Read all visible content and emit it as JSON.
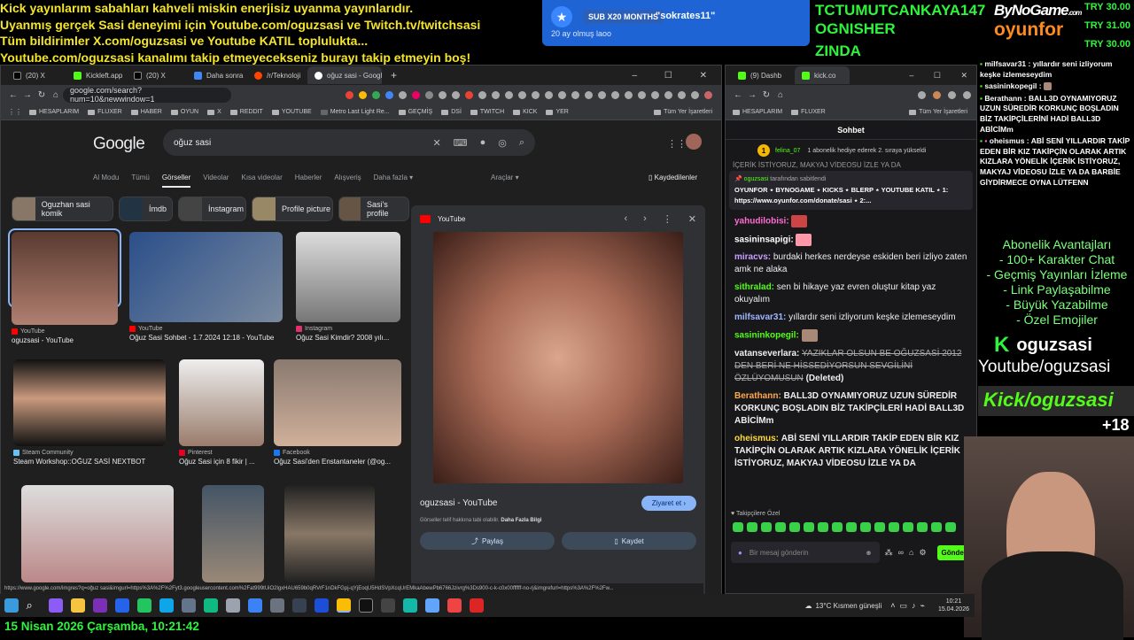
{
  "ticker": [
    "Kick yayınlarım sabahları kahveli miskin enerjisiz uyanma yayınlarıdır.",
    "Uyanmış gerçek Sasi deneyimi için Youtube.com/oguzsasi ve Twitch.tv/twitchsasi",
    "Tüm bildirimler X.com/oguzsasi ve Youtube KATIL toplulukta...",
    "Youtube.com/oguzsasi kanalımı takip etmeyecekseniz burayı takip etmeyin boş!"
  ],
  "sub_alert": {
    "tag": "SUB X20 MONTHS",
    "name": "\"sokrates11\"",
    "ago": "20 ay olmuş laoo"
  },
  "top_names": [
    "TCTUMUTCANKAYA147",
    "OGNISHER",
    "ZINDA"
  ],
  "logo": {
    "line1": "ByNoGame",
    "line1_small": ".com",
    "line2": "oyunfor"
  },
  "tries": [
    "TRY 30.00",
    "TRY 31.00",
    "TRY 30.00"
  ],
  "left_browser": {
    "tabs": [
      "(20) X",
      "Kickleft.app - Kick Chat",
      "(20) X",
      "Daha sonra oku",
      "/r/Teknoloji",
      "oğuz sasi - Google'da"
    ],
    "url": "google.com/search?num=10&newwindow=1",
    "bookmarks": [
      "HESAPLARIM",
      "FLUXER",
      "HABER",
      "OYUN",
      "X",
      "REDDIT",
      "YOUTUBE",
      "Metro Last Light Re...",
      "GEÇMİŞ",
      "DSİ",
      "TWITCH",
      "KICK",
      "YER"
    ],
    "bookmarks_all": "Tüm Yer İşaretleri",
    "search": {
      "query": "oğuz sasi",
      "logo": "Google"
    },
    "nav": [
      "Al Modu",
      "Tümü",
      "Görseller",
      "Videolar",
      "Kısa videolar",
      "Haberler",
      "Alışveriş",
      "Daha fazla ▾"
    ],
    "tools": "Araçlar ▾",
    "saved": "Kaydedilenler",
    "chips": [
      "Oguzhan sasi komik",
      "İmdb",
      "İnstagram",
      "Profile picture",
      "Sasi's profile"
    ],
    "results": [
      {
        "src": "YouTube",
        "title": "oguzsasi - YouTube"
      },
      {
        "src": "YouTube",
        "title": "Oğuz Sasi Sohbet - 1.7.2024 12:18 - YouTube"
      },
      {
        "src": "Instagram",
        "title": "Oğuz Sasi Kimdir? 2008 yılı..."
      },
      {
        "src": "Steam Community",
        "title": "Steam Workshop::OĞUZ SASİ NEXTBOT"
      },
      {
        "src": "Pinterest",
        "title": "Oğuz Sasi için 8 fikir | ..."
      },
      {
        "src": "Facebook",
        "title": "Oğuz Sasi'den Enstantaneler (@og..."
      }
    ],
    "preview": {
      "source": "YouTube",
      "title": "oguzsasi - YouTube",
      "copyright": "Görseller telif hakkına tabi olabilir.",
      "more": "Daha Fazla Bilgi",
      "visit": "Ziyaret et",
      "share": "Paylaş",
      "save": "Kaydet"
    },
    "status_url": "https://www.google.com/imgres?q=oğuz sasi&imgurl=https%3A%2F%2Fyt3.googleusercontent.com%2Fat999tUiO2lgxHAU659b0qRVrF1nDkFGpj-qYjEoqU5HdSVpXcqUrEMkaAbewPb6766Jzivrg%3Ds900-c-k-c0x00ffffff-no-rj&imgrefurl=https%3A%2F%2Fw..."
  },
  "right_browser": {
    "tabs": [
      "(9) Dashb",
      "kick.co"
    ],
    "bookmarks": [
      "HESAPLARIM",
      "FLUXER"
    ],
    "bookmarks_all": "Tüm Yer İşaretleri",
    "chat_title": "Sohbet",
    "gift_user": "felina_07",
    "gift_text": "1 abonelik hediye ederek 2. sıraya yükseldi",
    "pinned_cut": "İÇERİK İSTİYORUZ, MAKYAJ VİDEOSU İZLE YA DA",
    "pinned_by": "oguzsasi",
    "pinned_label": "tarafından sabitlendi",
    "pinned_text": "OYUNFOR ⋆ BYNOGAME ⋆ KICKS ⋆ BLERP ⋆ YOUTUBE KATIL ⋆ 1: https://www.oyunfor.com/donate/sasi ⋆ 2:...",
    "messages": [
      {
        "user": "yahudilobisi:",
        "text": "",
        "color": "#ff6bd3",
        "emote": true
      },
      {
        "user": "sasininsapigi:",
        "text": "",
        "color": "#fff",
        "emote": true
      },
      {
        "user": "miracvs:",
        "text": "burdaki herkes nerdeyse eskiden beri izliyo zaten amk ne alaka",
        "color": "#c9a0ff"
      },
      {
        "user": "sithralad:",
        "text": "sen bi hikaye yaz evren oluştur kitap yaz okuyalım",
        "color": "#53fc18"
      },
      {
        "user": "milfsavar31:",
        "text": "yıllardır seni izliyorum keşke izlemeseydim",
        "color": "#9fb6ff"
      },
      {
        "user": "sasininkopegil:",
        "text": "",
        "color": "#53fc18",
        "emote": true
      },
      {
        "user": "vatanseverlara:",
        "text": "YAZIKLAR OLSUN BE OĞUZSASİ 2012 DEN BERİ NE HİSSEDİYORSUN SEVGİLİNİ ÖZLÜYOMUSUN",
        "deleted": "(Deleted)",
        "color": "#fff",
        "strike": true
      },
      {
        "user": "Berathann:",
        "text": "BALL3D OYNAMIYORUZ UZUN SÜREDİR KORKUNÇ BOŞLADIN BİZ TAKİPÇİLERİ HADİ BALL3D ABİCİMm",
        "color": "#ffa94d"
      },
      {
        "user": "oheismus:",
        "text": "ABİ SENİ YILLARDIR TAKİP EDEN BİR KIZ TAKİPÇİN OLARAK ARTIK KIZLARA YÖNELİK İÇERİK İSTİYORUZ, MAKYAJ VİDEOSU İZLE YA DA",
        "color": "#ffd93d"
      }
    ],
    "followers_only": "Takipçilere Özel",
    "input_placeholder": "Bir mesaj gönderin",
    "send": "Gönder"
  },
  "overlay_chat": [
    {
      "user": "milfsavar31",
      "text": "yıllardır seni izliyorum keşke izlemeseydim"
    },
    {
      "user": "sasininkopegil",
      "text": ""
    },
    {
      "user": "Berathann",
      "text": "BALL3D OYNAMIYORUZ UZUN SÜREDİR KORKUNÇ BOŞLADIN BİZ TAKİPÇİLERİNİ HADİ BALL3D ABİCİMm"
    },
    {
      "user": "oheismus",
      "text": "ABİ SENİ YILLARDIR TAKİP EDEN BİR KIZ TAKİPÇİN OLARAK ARTIK KIZLARA YÖNELİK İÇERİK İSTİYORUZ, MAKYAJ VİDEOSU İZLE YA DA BARBİE GİYDİRMECE OYNA LÜTFENN"
    }
  ],
  "advantages": [
    "Abonelik Avantajları",
    "- 100+ Karakter Chat",
    "- Geçmiş Yayınları İzleme",
    "- Link Paylaşabilme",
    "- Büyük Yazabilme",
    "- Özel Emojiler"
  ],
  "brand": {
    "handle": "oguzsasi",
    "youtube": "Youtube/oguzsasi",
    "kick": "Kick/oguzsasi",
    "age": "+18"
  },
  "taskbar": {
    "weather": "13°C  Kısmen güneşli",
    "time": "10:21",
    "date": "15.04.2026"
  },
  "clock": "15 Nisan 2026 Çarşamba, 10:21:42",
  "colors": {
    "ticker": "#f5e52a",
    "green": "#2df53c",
    "sub_blue": "#1e64d4",
    "kick_green": "#53fc18"
  }
}
